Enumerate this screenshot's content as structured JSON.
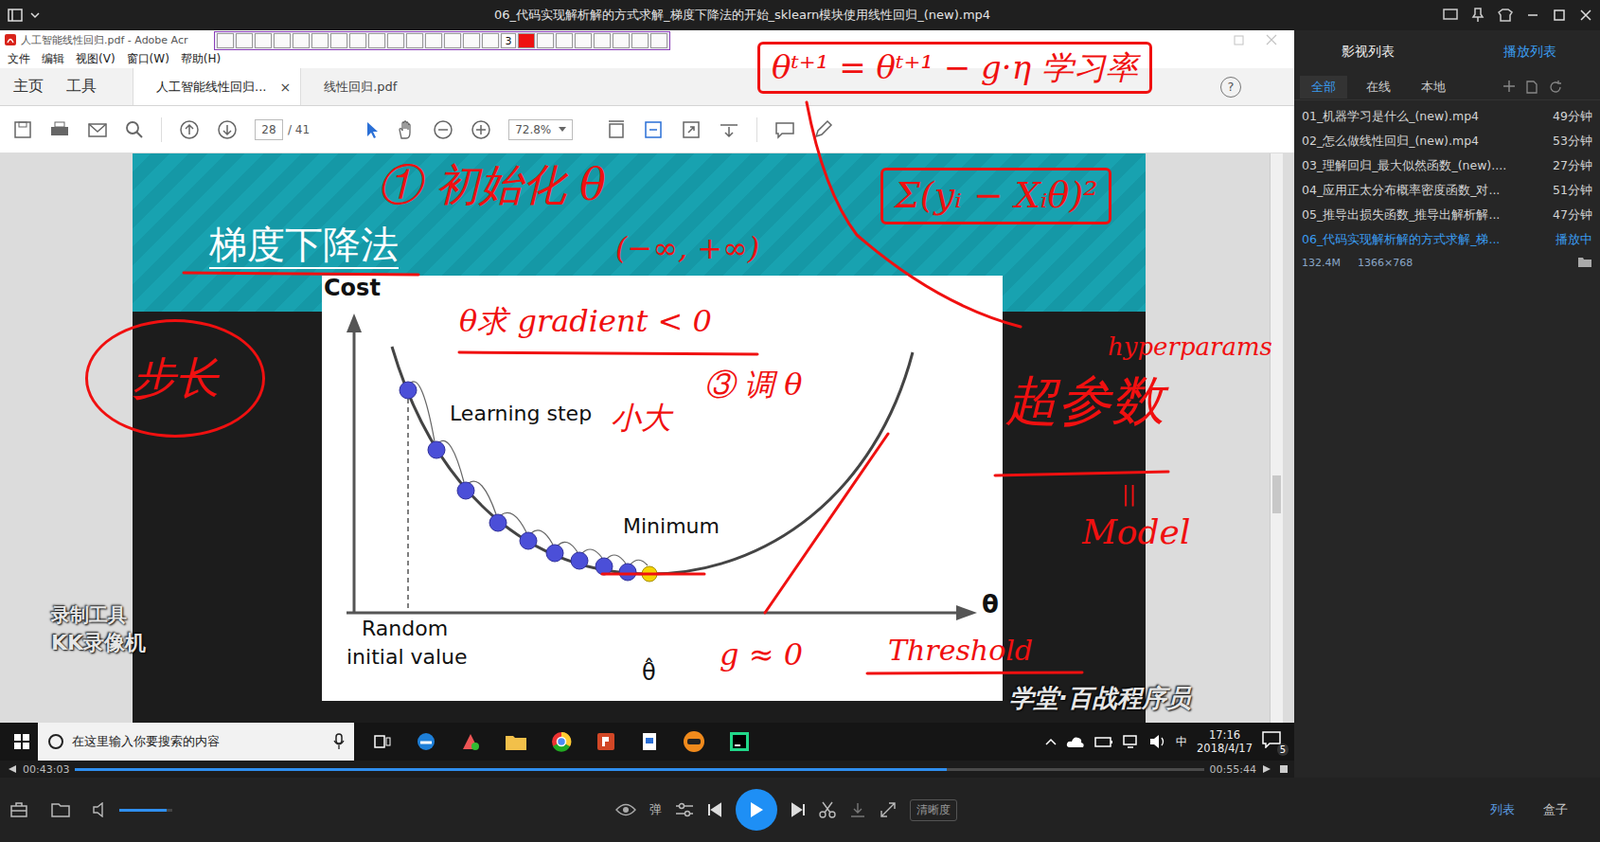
{
  "player": {
    "title": "06_代码实现解析解的方式求解_梯度下降法的开始_sklearn模块使用线性回归_(new).mp4",
    "elapsed": "00:43:03",
    "total": "00:55:44",
    "progress": 0.772,
    "volume": 0.9,
    "danmaku": "弹",
    "quality": "清晰度",
    "corner_tabs": [
      {
        "label": "列表",
        "selected": true
      },
      {
        "label": "盒子",
        "selected": false
      }
    ]
  },
  "panel": {
    "tabs": [
      {
        "label": "影视列表",
        "selected": false
      },
      {
        "label": "播放列表",
        "selected": true
      }
    ],
    "filters": [
      {
        "label": "全部",
        "selected": true
      },
      {
        "label": "在线",
        "selected": false
      },
      {
        "label": "本地",
        "selected": false
      }
    ],
    "items": [
      {
        "name": "01_机器学习是什么_(new).mp4",
        "duration": "49分钟",
        "selected": false
      },
      {
        "name": "02_怎么做线性回归_(new).mp4",
        "duration": "53分钟",
        "selected": false
      },
      {
        "name": "03_理解回归_最大似然函数_(new)....",
        "duration": "27分钟",
        "selected": false
      },
      {
        "name": "04_应用正太分布概率密度函数_对...",
        "duration": "51分钟",
        "selected": false
      },
      {
        "name": "05_推导出损失函数_推导出解析解...",
        "duration": "47分钟",
        "selected": false
      },
      {
        "name": "06_代码实现解析解的方式求解_梯...",
        "duration": "播放中",
        "selected": true
      }
    ],
    "info": {
      "size": "132.4M",
      "resolution": "1366×768"
    }
  },
  "video": {
    "acrobat": {
      "title": "人工智能线性回归.pdf - Adobe Acr",
      "menu": [
        "文件",
        "编辑",
        "视图(V)",
        "窗口(W)",
        "帮助(H)"
      ],
      "nav": [
        "主页",
        "工具"
      ],
      "doc_tabs": [
        {
          "label": "人工智能线性回归...",
          "close": "×",
          "selected": true
        },
        {
          "label": "线性回归.pdf",
          "selected": false
        }
      ],
      "help": "?",
      "page": "28",
      "page_total": "/ 41",
      "zoom": "72.8%"
    },
    "recorder": {
      "pen_size": "3"
    },
    "slide": {
      "title": "梯度下降法",
      "chart": {
        "y_label": "Cost",
        "x_label": "θ",
        "step_label": "Learning step",
        "min_label": "Minimum",
        "start_label_1": "Random",
        "start_label_2": "initial value",
        "optimum_label": "θ̂"
      }
    },
    "annotations": [
      {
        "text": "θᵗ⁺¹ = θᵗ⁺¹ − g·η 学习率",
        "kind": "boxed"
      },
      {
        "text": "Σ(yᵢ − Xᵢθ)²",
        "kind": "boxed"
      },
      {
        "text": "① 初始化 θ",
        "kind": "plain"
      },
      {
        "text": "(−∞, +∞)",
        "kind": "plain"
      },
      {
        "text": "θ求 gradient < 0",
        "kind": "plain"
      },
      {
        "text": "③ 调 θ",
        "kind": "plain"
      },
      {
        "text": "小大",
        "kind": "plain"
      },
      {
        "text": "步长",
        "kind": "circled"
      },
      {
        "text": "hyperparams",
        "kind": "plain"
      },
      {
        "text": "超参数",
        "kind": "plain"
      },
      {
        "text": "||",
        "kind": "plain"
      },
      {
        "text": "Model",
        "kind": "plain"
      },
      {
        "text": "Threshold",
        "kind": "plain"
      },
      {
        "text": "g ≈ 0",
        "kind": "plain"
      }
    ],
    "watermarks": {
      "tool": "录制工具",
      "recorder": "KK录像机",
      "brand": "学堂·百战程序员"
    },
    "taskbar": {
      "search": "在这里输入你要搜索的内容",
      "ime": "中",
      "time": "17:16",
      "date": "2018/4/17",
      "notifications": "5"
    }
  }
}
